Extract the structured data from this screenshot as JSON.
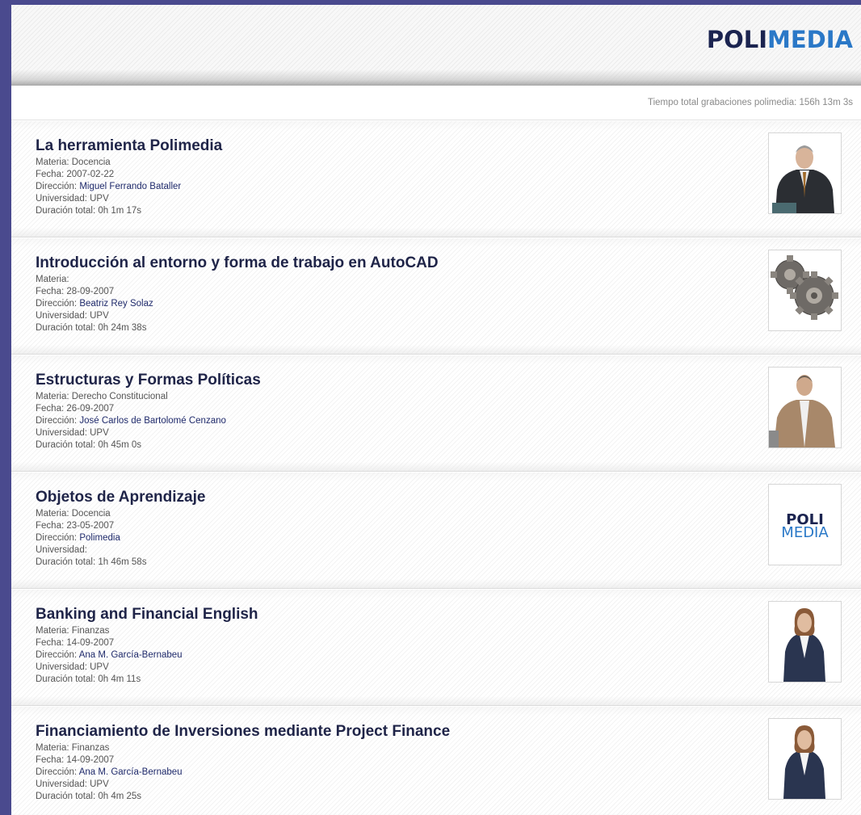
{
  "header": {
    "logo_poli": "POLI",
    "logo_media": "MEDIA",
    "total_label": "Tiempo total grabaciones polimedia:",
    "total_value": "156h 13m 3s"
  },
  "labels": {
    "materia": "Materia:",
    "fecha": "Fecha:",
    "direccion": "Dirección:",
    "universidad": "Universidad:",
    "duracion": "Duración total:"
  },
  "items": [
    {
      "title": "La herramienta Polimedia",
      "materia": "Docencia",
      "fecha": "2007-02-22",
      "direccion": "Miguel Ferrando Bataller",
      "universidad": "UPV",
      "duracion": "0h 1m 17s",
      "thumb": "presenter-man-suit"
    },
    {
      "title": "Introducción al entorno y forma de trabajo en AutoCAD",
      "materia": "",
      "fecha": "28-09-2007",
      "direccion": "Beatriz Rey Solaz",
      "universidad": "UPV",
      "duracion": "0h 24m 38s",
      "thumb": "gears-icon"
    },
    {
      "title": "Estructuras y Formas Políticas",
      "materia": "Derecho Constitucional",
      "fecha": "26-09-2007",
      "direccion": "José Carlos de Bartolomé Cenzano",
      "universidad": "UPV",
      "duracion": "0h 45m 0s",
      "thumb": "presenter-man-beige"
    },
    {
      "title": "Objetos de Aprendizaje",
      "materia": "Docencia",
      "fecha": "23-05-2007",
      "direccion": "Polimedia",
      "universidad": "",
      "duracion": "1h 46m 58s",
      "thumb": "polimedia-logo",
      "thumb_poli": "POLI",
      "thumb_media": "MEDIA"
    },
    {
      "title": "Banking and Financial English",
      "materia": "Finanzas",
      "fecha": "14-09-2007",
      "direccion": "Ana M. García-Bernabeu",
      "universidad": "UPV",
      "duracion": "0h 4m 11s",
      "thumb": "presenter-woman"
    },
    {
      "title": "Financiamiento de Inversiones mediante Project Finance",
      "materia": "Finanzas",
      "fecha": "14-09-2007",
      "direccion": "Ana M. García-Bernabeu",
      "universidad": "UPV",
      "duracion": "0h 4m 25s",
      "thumb": "presenter-woman"
    }
  ]
}
